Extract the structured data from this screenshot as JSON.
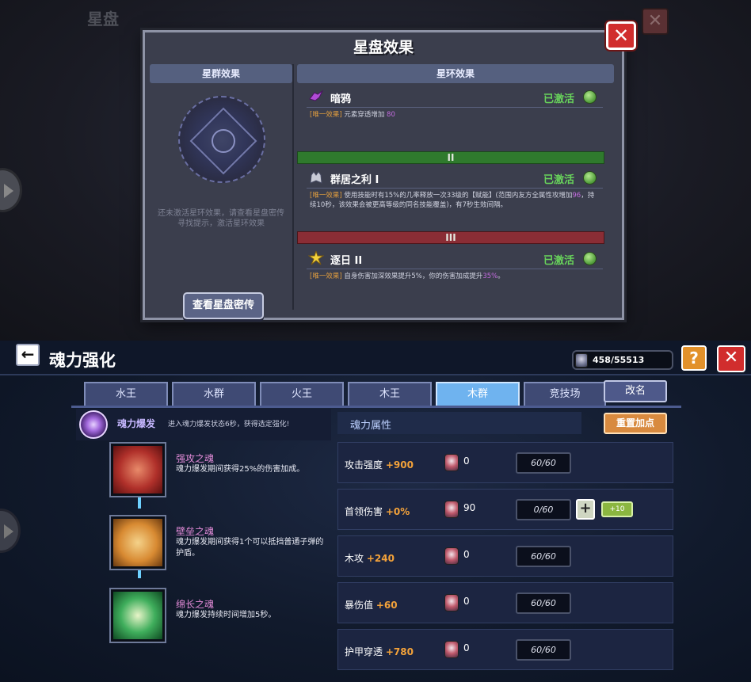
{
  "background": {
    "title": "星盘"
  },
  "modal": {
    "title": "星盘效果",
    "left": {
      "header": "星群效果",
      "hint": "还未激活星环效果，请查看星盘密传寻找提示，激活星环效果",
      "button": "查看星盘密传"
    },
    "right": {
      "header": "星环效果",
      "entries": [
        {
          "name": "暗鸦",
          "status": "已激活",
          "tag": "[唯一效果]",
          "desc": " 元素穿透增加",
          "highlight": " 80"
        },
        {
          "tier": "II",
          "name": "群居之利 I",
          "status": "已激活",
          "tag": "[唯一效果]",
          "desc": " 使用技能时有15%的几率释放一次33级的【赋能】(范围内友方全属性攻增加",
          "highlight": "96",
          "desc2": "，持续10秒，该效果会被更高等级的同名技能覆盖)，有7秒生效间隔。"
        },
        {
          "tier": "III",
          "name": "逐日 II",
          "status": "已激活",
          "tag": "[唯一效果]",
          "desc": " 自身伤害加深效果提升5%，你的伤害加成提升",
          "highlight": "35%",
          "desc2": "。"
        }
      ]
    }
  },
  "soul": {
    "title": "魂力强化",
    "currency": "458/55513",
    "help_label": "?",
    "tabs": [
      "水王",
      "水群",
      "火王",
      "木王",
      "木群",
      "竞技场"
    ],
    "active_tab": 4,
    "rename_label": "改名",
    "burst": {
      "name": "魂力爆发",
      "desc": "进入魂力爆发状态6秒，获得选定强化!"
    },
    "skills": [
      {
        "name": "强攻之魂",
        "desc": "魂力爆发期间获得25%的伤害加成。"
      },
      {
        "name": "壁垒之魂",
        "desc": "魂力爆发期间获得1个可以抵挡普通子弹的护盾。"
      },
      {
        "name": "绵长之魂",
        "desc": "魂力爆发持续时间增加5秒。"
      }
    ],
    "attr_header": "魂力属性",
    "reset_label": "重置加点",
    "attrs": [
      {
        "name": "攻击强度",
        "bonus": "+900",
        "cost": "0",
        "progress": "60/60"
      },
      {
        "name": "首领伤害",
        "bonus": "+0%",
        "cost": "90",
        "progress": "0/60",
        "plus": "+",
        "plus10": "+10"
      },
      {
        "name": "木攻",
        "bonus": "+240",
        "cost": "0",
        "progress": "60/60"
      },
      {
        "name": "暴伤值",
        "bonus": "+60",
        "cost": "0",
        "progress": "60/60"
      },
      {
        "name": "护甲穿透",
        "bonus": "+780",
        "cost": "0",
        "progress": "60/60"
      }
    ],
    "colors": {
      "bonus": "#f3a23a",
      "active_tab": "#6fb3ef",
      "status_active": "#68d35b"
    }
  }
}
